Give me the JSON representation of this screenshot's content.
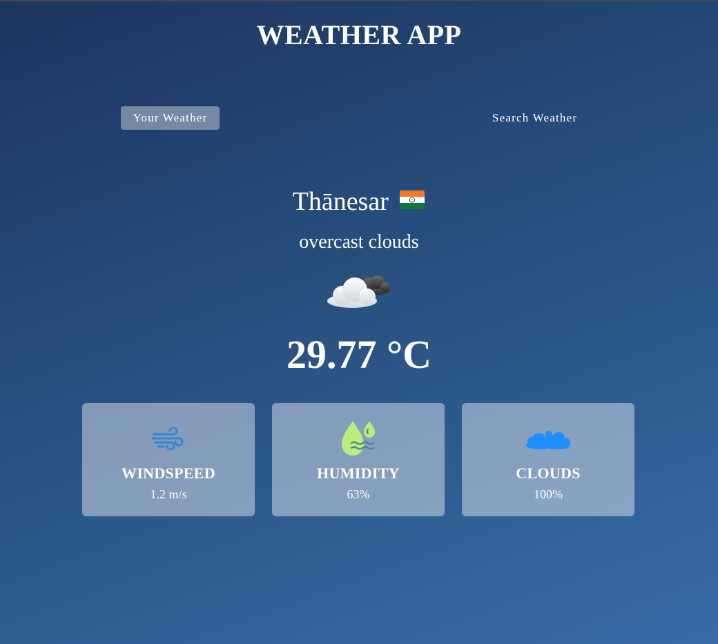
{
  "app": {
    "title": "WEATHER APP"
  },
  "tabs": [
    {
      "label": "Your Weather",
      "active": true
    },
    {
      "label": "Search Weather",
      "active": false
    }
  ],
  "location": {
    "city": "Thānesar",
    "country_flag_icon": "india-flag-icon"
  },
  "current": {
    "description": "overcast clouds",
    "icon": "overcast-clouds-icon",
    "temperature": "29.77 °C"
  },
  "stats": [
    {
      "label": "WINDSPEED",
      "value": "1.2 m/s",
      "icon": "wind-icon",
      "color": "#2f86d6"
    },
    {
      "label": "HUMIDITY",
      "value": "63%",
      "icon": "humidity-drops-icon",
      "color": "#b7ef7a"
    },
    {
      "label": "CLOUDS",
      "value": "100%",
      "icon": "clouds-icon",
      "color": "#1e8fff"
    }
  ],
  "colors": {
    "background_start": "#1b355e",
    "background_end": "#3a6aa6",
    "card_background": "rgba(255,255,255,0.42)",
    "text": "#ffffff"
  }
}
